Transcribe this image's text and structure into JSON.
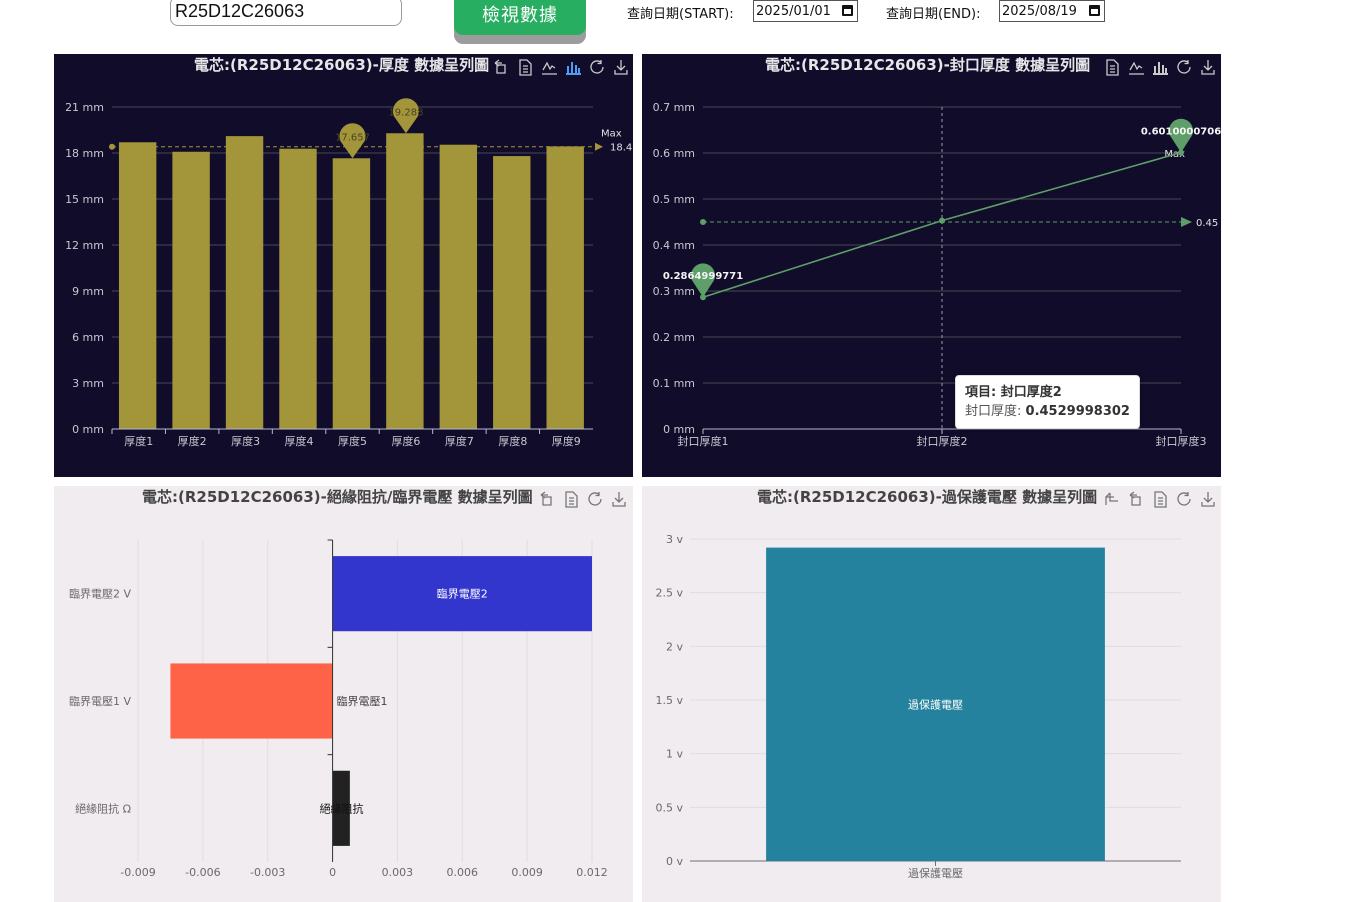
{
  "controls": {
    "cell_id_value": "R25D12C26063",
    "view_button": "檢視數據",
    "start_label": "查詢日期(START):",
    "start_date": "2025/01/01",
    "end_label": "查詢日期(END):",
    "end_date": "2025/08/19"
  },
  "charts": [
    {
      "key": "thickness",
      "title": "電芯:(R25D12C26063)-厚度 數據呈列圖",
      "theme": "dark",
      "toolbar": [
        "restore-icon",
        "data-view-icon",
        "line-type-icon",
        "bar-type-icon",
        "refresh-icon",
        "save-image-icon"
      ],
      "active_tool": "bar-type-icon"
    },
    {
      "key": "seal",
      "title": "電芯:(R25D12C26063)-封口厚度 數據呈列圖",
      "theme": "dark",
      "toolbar": [
        "data-view-icon",
        "line-type-icon",
        "bar-type-icon",
        "refresh-icon",
        "save-image-icon"
      ]
    },
    {
      "key": "insulation",
      "title": "電芯:(R25D12C26063)-絕緣阻抗/臨界電壓 數據呈列圖",
      "theme": "light",
      "toolbar": [
        "restore-icon",
        "data-view-icon",
        "refresh-icon",
        "save-image-icon"
      ]
    },
    {
      "key": "overprotect",
      "title": "電芯:(R25D12C26063)-過保護電壓 數據呈列圖",
      "theme": "light",
      "toolbar": [
        "zoom-icon",
        "restore-icon",
        "data-view-icon",
        "refresh-icon",
        "save-image-icon"
      ]
    }
  ],
  "tooltip": {
    "title": "項目: 封口厚度2",
    "label": "封口厚度:",
    "value": "0.4529998302"
  },
  "chart_data": [
    {
      "type": "bar",
      "categories": [
        "厚度1",
        "厚度2",
        "厚度3",
        "厚度4",
        "厚度5",
        "厚度6",
        "厚度7",
        "厚度8",
        "厚度9"
      ],
      "values": [
        18.7,
        18.08,
        19.1,
        18.28,
        17.657,
        19.288,
        18.54,
        17.8,
        18.43
      ],
      "yunit": "mm",
      "yticks": [
        "0 mm",
        "3 mm",
        "6 mm",
        "9 mm",
        "12 mm",
        "15 mm",
        "18 mm",
        "21 mm"
      ],
      "ylim": [
        0,
        21
      ],
      "markpoints": [
        {
          "label": "19.288",
          "index": 5
        },
        {
          "label": "17.657",
          "index": 4
        }
      ],
      "markline": {
        "label": "Max",
        "value": "18.41"
      },
      "color": "#a39539",
      "grid": true
    },
    {
      "type": "line",
      "categories": [
        "封口厚度1",
        "封口厚度2",
        "封口厚度3"
      ],
      "values": [
        0.2864999771,
        0.4529998302,
        0.6010000706
      ],
      "yticks": [
        "0 mm",
        "0.1 mm",
        "0.2 mm",
        "0.3 mm",
        "0.4 mm",
        "0.5 mm",
        "0.6 mm",
        "0.7 mm"
      ],
      "ylim": [
        0,
        0.7
      ],
      "markpoints": [
        {
          "label": "0.6010000706",
          "index": 2
        },
        {
          "label": "0.2864999771",
          "index": 0
        }
      ],
      "markline": {
        "label": "Max",
        "value": "0.45"
      },
      "color": "#5e9e68",
      "grid": true
    },
    {
      "type": "bar",
      "orientation": "horizontal",
      "categories": [
        "絕緣阻抗 Ω",
        "臨界電壓1 V",
        "臨界電壓2 V"
      ],
      "bar_labels": [
        "絕緣阻抗",
        "臨界電壓1",
        "臨界電壓2"
      ],
      "values": [
        0.0008,
        -0.0075,
        0.012
      ],
      "colors": [
        "#222222",
        "#ff6347",
        "#3336cc"
      ],
      "xticks": [
        "-0.009",
        "-0.006",
        "-0.003",
        "0",
        "0.003",
        "0.006",
        "0.009",
        "0.012"
      ],
      "xlim": [
        -0.009,
        0.012
      ],
      "grid": true
    },
    {
      "type": "bar",
      "categories": [
        "過保護電壓"
      ],
      "bar_labels": [
        "過保護電壓"
      ],
      "values": [
        2.92
      ],
      "yticks": [
        "0 v",
        "0.5 v",
        "1 v",
        "1.5 v",
        "2 v",
        "2.5 v",
        "3 v"
      ],
      "ylim": [
        0,
        3
      ],
      "color": "#24829e",
      "grid": true
    }
  ]
}
